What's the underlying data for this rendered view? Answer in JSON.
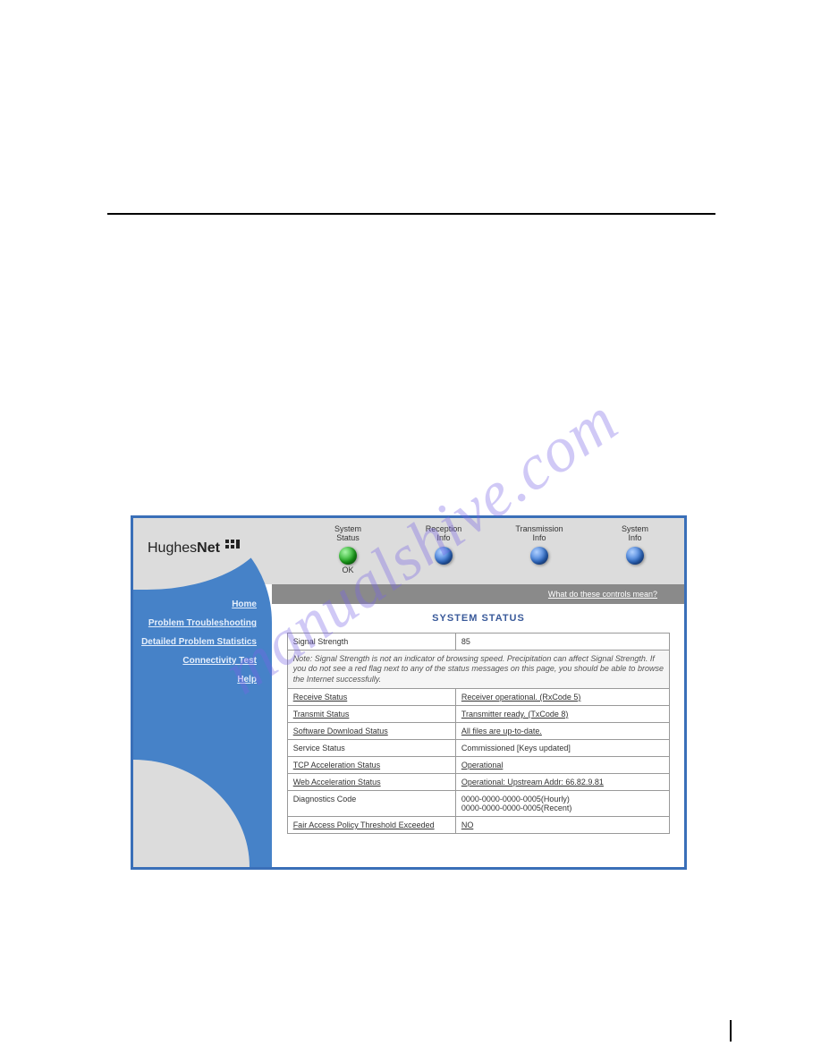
{
  "watermark": "manualshive.com",
  "brand": {
    "name_light": "Hughes",
    "name_bold": "Net"
  },
  "nav_orbs": [
    {
      "line1": "System",
      "line2": "Status",
      "klass": "orb-green",
      "sub": "OK"
    },
    {
      "line1": "Reception",
      "line2": "Info",
      "klass": "orb-blue",
      "sub": ""
    },
    {
      "line1": "Transmission",
      "line2": "Info",
      "klass": "orb-blue",
      "sub": ""
    },
    {
      "line1": "System",
      "line2": "Info",
      "klass": "orb-blue",
      "sub": ""
    }
  ],
  "subbar_link": "What do these controls mean?",
  "sidebar": {
    "items": [
      "Home",
      "Problem Troubleshooting",
      "Detailed Problem Statistics",
      "Connectivity Test",
      "Help"
    ]
  },
  "panel": {
    "title": "SYSTEM STATUS",
    "note": "Note: Signal Strength is not an indicator of browsing speed. Precipitation can affect Signal Strength. If you do not see a red flag next to any of the status messages on this page, you should be able to browse the Internet successfully.",
    "rows": [
      {
        "label": "Signal Strength",
        "value": "85",
        "label_link": false,
        "value_link": false
      },
      {
        "label": "Receive Status",
        "value": "Receiver operational. (RxCode 5)",
        "label_link": true,
        "value_link": true
      },
      {
        "label": "Transmit Status",
        "value": "Transmitter ready. (TxCode 8)",
        "label_link": true,
        "value_link": true
      },
      {
        "label": "Software Download Status",
        "value": "All files are up-to-date.",
        "label_link": true,
        "value_link": true
      },
      {
        "label": "Service Status",
        "value": "Commissioned [Keys updated]",
        "label_link": false,
        "value_link": false
      },
      {
        "label": "TCP Acceleration Status",
        "value": "Operational",
        "label_link": true,
        "value_link": true
      },
      {
        "label": "Web Acceleration Status",
        "value": "Operational: Upstream Addr: 66.82.9.81",
        "label_link": true,
        "value_link": true
      },
      {
        "label": "Diagnostics Code",
        "value": "0000-0000-0000-0005(Hourly)\n0000-0000-0000-0005(Recent)",
        "label_link": false,
        "value_link": false
      },
      {
        "label": "Fair Access Policy Threshold Exceeded",
        "value": "NO",
        "label_link": true,
        "value_link": true
      }
    ]
  }
}
